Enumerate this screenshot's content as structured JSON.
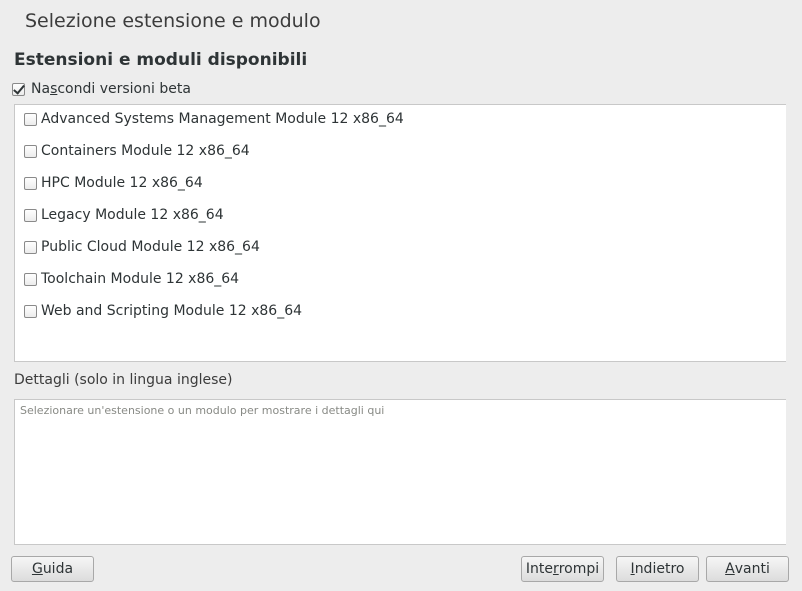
{
  "page": {
    "title": "Selezione estensione e modulo"
  },
  "section": {
    "title": "Estensioni e moduli disponibili"
  },
  "beta_filter": {
    "label_pre": "Na",
    "label_mnemonic": "s",
    "label_post": "condi versioni beta",
    "checked": true
  },
  "modules": [
    {
      "label": "Advanced Systems Management Module 12 x86_64",
      "checked": false
    },
    {
      "label": "Containers Module 12 x86_64",
      "checked": false
    },
    {
      "label": "HPC Module 12 x86_64",
      "checked": false
    },
    {
      "label": "Legacy Module 12 x86_64",
      "checked": false
    },
    {
      "label": "Public Cloud Module 12 x86_64",
      "checked": false
    },
    {
      "label": "Toolchain Module 12 x86_64",
      "checked": false
    },
    {
      "label": "Web and Scripting Module 12 x86_64",
      "checked": false
    }
  ],
  "details": {
    "label": "Dettagli (solo in lingua inglese)",
    "placeholder": "Selezionare un'estensione o un modulo per mostrare i dettagli qui"
  },
  "buttons": {
    "help": {
      "pre": "",
      "mnemonic": "G",
      "post": "uida"
    },
    "abort": {
      "pre": "Inte",
      "mnemonic": "r",
      "post": "rompi"
    },
    "back": {
      "pre": "",
      "mnemonic": "I",
      "post": "ndietro"
    },
    "next": {
      "pre": "",
      "mnemonic": "A",
      "post": "vanti"
    }
  }
}
